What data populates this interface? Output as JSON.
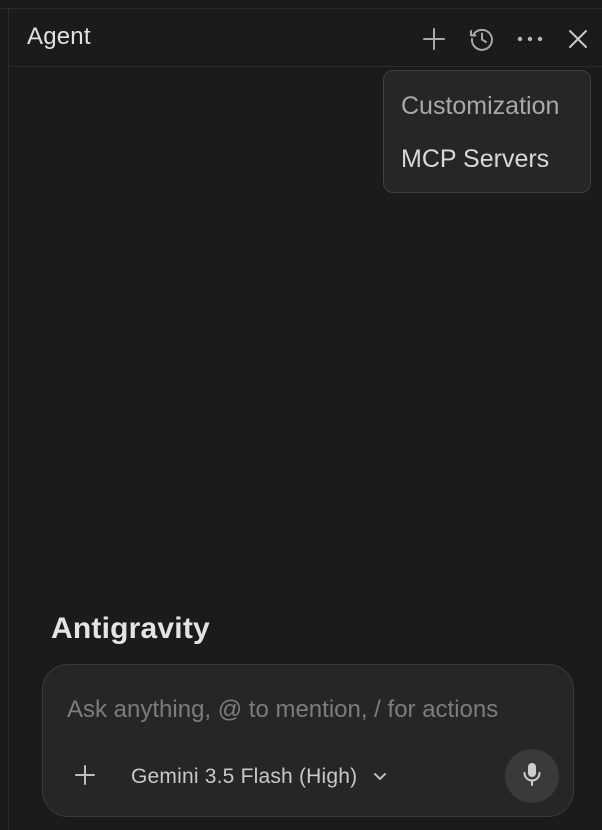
{
  "header": {
    "title": "Agent",
    "actions": [
      {
        "name": "new-chat",
        "icon": "plus-icon"
      },
      {
        "name": "history",
        "icon": "history-icon"
      },
      {
        "name": "more",
        "icon": "ellipsis-icon"
      },
      {
        "name": "close",
        "icon": "close-icon"
      }
    ]
  },
  "menu": {
    "items": [
      {
        "label": "Customization"
      },
      {
        "label": "MCP Servers"
      }
    ]
  },
  "brand": {
    "title": "Antigravity"
  },
  "composer": {
    "placeholder": "Ask anything, @ to mention, / for actions",
    "value": "",
    "add_icon": "plus-icon",
    "model_label": "Gemini 3.5 Flash (High)",
    "model_icon": "chevron-down-icon",
    "mic_icon": "microphone-icon"
  },
  "colors": {
    "background": "#1b1b1b",
    "panel": "#262626",
    "border": "#3a3a3a",
    "text": "#d6d6d6",
    "muted": "#7c7c7c"
  }
}
